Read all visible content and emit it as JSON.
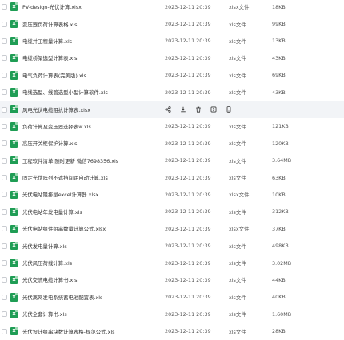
{
  "files": [
    {
      "name": "PV-design-光伏计算.xlsx",
      "date": "2023-12-11 20:39",
      "type": "xlsx文件",
      "size": "18KB"
    },
    {
      "name": "变压器负荷计算表格.xls",
      "date": "2023-12-11 20:39",
      "type": "xls文件",
      "size": "99KB"
    },
    {
      "name": "电缆并工程量计算.xls",
      "date": "2023-12-11 20:39",
      "type": "xls文件",
      "size": "13KB"
    },
    {
      "name": "电缆桥架选型计算表.xls",
      "date": "2023-12-11 20:39",
      "type": "xls文件",
      "size": "43KB"
    },
    {
      "name": "电气负荷计算表(完美版).xls",
      "date": "2023-12-11 20:39",
      "type": "xls文件",
      "size": "69KB"
    },
    {
      "name": "电线选型、线管选型小型计算软件.xls",
      "date": "2023-12-11 20:39",
      "type": "xls文件",
      "size": "43KB"
    },
    {
      "name": "风电光伏电缆阻抗计算表.xlsx",
      "hovered": true
    },
    {
      "name": "负荷计算及变压器选择表w.xls",
      "date": "2023-12-11 20:39",
      "type": "xls文件",
      "size": "121KB"
    },
    {
      "name": "高压开关柜保护计算.xls",
      "date": "2023-12-11 20:39",
      "type": "xls文件",
      "size": "120KB"
    },
    {
      "name": "工程软件清单  随时更新 微信7698356.xls",
      "date": "2023-12-11 20:39",
      "type": "xls文件",
      "size": "3.64MB"
    },
    {
      "name": "固定光伏阵列不遮挡间距自动计算.xls",
      "date": "2023-12-11 20:39",
      "type": "xls文件",
      "size": "63KB"
    },
    {
      "name": "光伏电站阻排量excel计算器.xlsx",
      "date": "2023-12-11 20:39",
      "type": "xlsx文件",
      "size": "10KB"
    },
    {
      "name": "光伏电站年发电量计算.xls",
      "date": "2023-12-11 20:39",
      "type": "xls文件",
      "size": "312KB"
    },
    {
      "name": "光伏电站组件组串数量计算公式.xlsx",
      "date": "2023-12-11 20:39",
      "type": "xlsx文件",
      "size": "37KB"
    },
    {
      "name": "光伏发电量计算.xls",
      "date": "2023-12-11 20:39",
      "type": "xls文件",
      "size": "498KB"
    },
    {
      "name": "光伏风压荷载计算.xls",
      "date": "2023-12-11 20:39",
      "type": "xls文件",
      "size": "3.02MB"
    },
    {
      "name": "光伏交流电缆计算书.xls",
      "date": "2023-12-11 20:39",
      "type": "xls文件",
      "size": "44KB"
    },
    {
      "name": "光伏离网发电系统蓄电池配置表.xls",
      "date": "2023-12-11 20:39",
      "type": "xls文件",
      "size": "40KB"
    },
    {
      "name": "光伏全套计算书.xls",
      "date": "2023-12-11 20:39",
      "type": "xls文件",
      "size": "1.60MB"
    },
    {
      "name": "光伏设计组串块数计算表格-规范公式.xls",
      "date": "2023-12-11 20:39",
      "type": "xls文件",
      "size": "28KB"
    }
  ],
  "file_icon_letter": "X",
  "file_icon_color": "#1f9d55",
  "hover_actions": [
    "share-icon",
    "download-icon",
    "delete-icon",
    "more-icon",
    "mobile-icon"
  ]
}
